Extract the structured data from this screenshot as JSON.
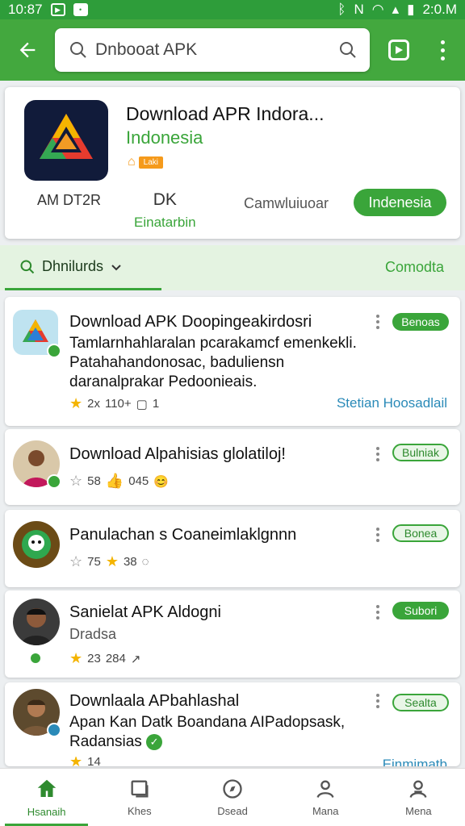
{
  "status_bar": {
    "time": "10:87",
    "right_text": "2:0.M"
  },
  "search": {
    "query": "Dnbooat APK"
  },
  "hero": {
    "title": "Download APR Indora...",
    "subtitle": "Indonesia",
    "badge": "Laki",
    "stat_left": "AM DT2R",
    "stat_mid_value": "DK",
    "stat_mid_label": "Einatarbin",
    "stat_right": "Camwluiuoar",
    "button_label": "Indenesia"
  },
  "filter": {
    "label": "Dhnilurds",
    "right_label": "Comodta"
  },
  "cards": [
    {
      "title": "Download APK Doopingeakirdosri",
      "desc": "Tamlarnhahlaralan pcarakamcf emenkekli. Patahahandonosac, baduliensn daranalprakar Pedoonieais.",
      "rating": "2x",
      "count1": "110+",
      "count2": "1",
      "link": "Stetian Hoosadlail",
      "pill": "Benoas"
    },
    {
      "title": "Download Alpahisias glolatiloj!",
      "rating": "58",
      "count1": "045",
      "pill": "Bulniak"
    },
    {
      "title": "Panulachan s Coaneimlaklgnnn",
      "rating": "75",
      "count1": "38",
      "pill": "Bonea"
    },
    {
      "title": "Sanielat APK Aldogni",
      "sub": "Dradsa",
      "rating": "23",
      "count1": "284",
      "pill": "Subori"
    },
    {
      "title": "Downlaala APbahlashal",
      "desc": "Apan Kan Datk Boandana AIPadopsask, Radansias",
      "rating": "14",
      "link": "Einmimatb",
      "pill": "Sealta"
    }
  ],
  "bottom_nav": [
    {
      "label": "Hsanaih",
      "icon": "home-icon"
    },
    {
      "label": "Khes",
      "icon": "card-icon"
    },
    {
      "label": "Dsead",
      "icon": "compass-icon"
    },
    {
      "label": "Mana",
      "icon": "person-icon"
    },
    {
      "label": "Mena",
      "icon": "profile-icon"
    }
  ],
  "colors": {
    "primary": "#43a83e",
    "accent": "#3aa53a",
    "link": "#2a8ab8",
    "star": "#f4b400"
  }
}
